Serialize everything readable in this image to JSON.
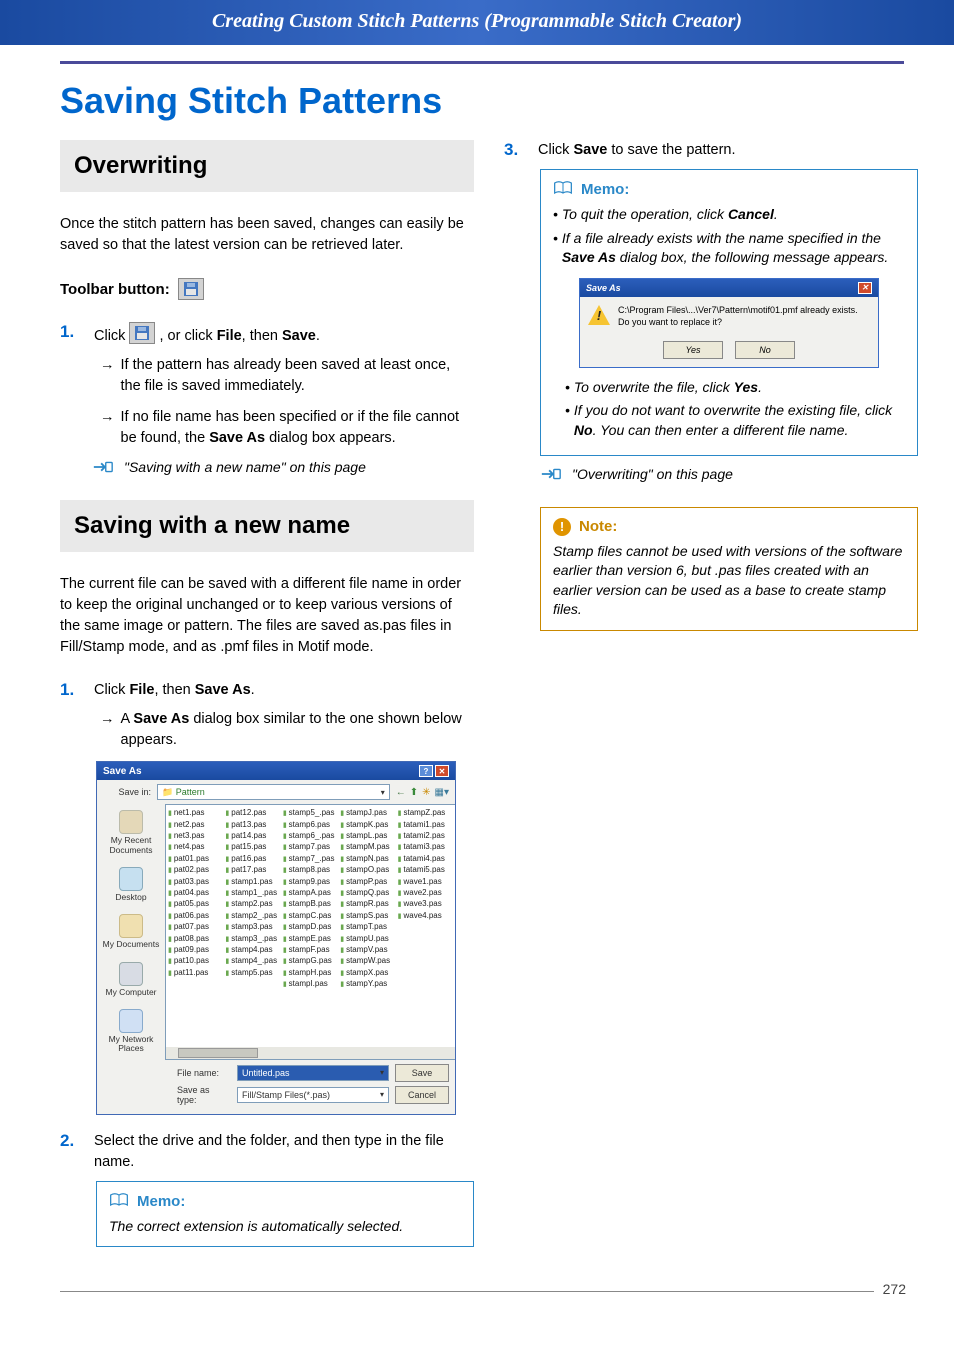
{
  "header_title": "Creating Custom Stitch Patterns (Programmable Stitch Creator)",
  "page_title": "Saving Stitch Patterns",
  "page_number": "272",
  "left": {
    "section1_heading": "Overwriting",
    "section1_intro": "Once the stitch pattern has been saved, changes can easily be saved so that the latest version can be retrieved later.",
    "toolbar_label": "Toolbar button:",
    "step1_num": "1.",
    "step1_pre": "Click ",
    "step1_mid": " , or click ",
    "step1_b1": "File",
    "step1_mid2": ", then ",
    "step1_b2": "Save",
    "step1_end": ".",
    "arrow1": "If the pattern has already been saved at least once, the file is saved immediately.",
    "arrow2_pre": "If no file name has been specified or if the file cannot be found, the ",
    "arrow2_b": "Save As",
    "arrow2_post": " dialog box appears.",
    "xref1": "\"Saving with a new name\" on this page",
    "section2_heading": "Saving with a new name",
    "section2_intro": "The current file can be saved with a different file name in order to keep the original unchanged or to keep various versions of the same image or pattern. The files are saved as.pas files in Fill/Stamp mode, and as .pmf files in Motif mode.",
    "s2_step1_num": "1.",
    "s2_step1_pre": "Click ",
    "s2_step1_b1": "File",
    "s2_step1_mid": ", then ",
    "s2_step1_b2": "Save As",
    "s2_step1_end": ".",
    "s2_arrow_pre": "A ",
    "s2_arrow_b": "Save As",
    "s2_arrow_post": " dialog box similar to the one shown below appears.",
    "s2_step2_num": "2.",
    "s2_step2_text": "Select the drive and the folder, and then type in the file name.",
    "memo1_label": "Memo:",
    "memo1_body": "The correct extension is automatically selected.",
    "dialog": {
      "title": "Save As",
      "savein_label": "Save in:",
      "savein_value": "Pattern",
      "sidebar": [
        "My Recent Documents",
        "Desktop",
        "My Documents",
        "My Computer",
        "My Network Places"
      ],
      "cols": [
        [
          "net1.pas",
          "net2.pas",
          "net3.pas",
          "net4.pas",
          "pat01.pas",
          "pat02.pas",
          "pat03.pas",
          "pat04.pas",
          "pat05.pas",
          "pat06.pas",
          "pat07.pas",
          "pat08.pas",
          "pat09.pas",
          "pat10.pas",
          "pat11.pas"
        ],
        [
          "pat12.pas",
          "pat13.pas",
          "pat14.pas",
          "pat15.pas",
          "pat16.pas",
          "pat17.pas",
          "stamp1.pas",
          "stamp1_.pas",
          "stamp2.pas",
          "stamp2_.pas",
          "stamp3.pas",
          "stamp3_.pas",
          "stamp4.pas",
          "stamp4_.pas",
          "stamp5.pas"
        ],
        [
          "stamp5_.pas",
          "stamp6.pas",
          "stamp6_.pas",
          "stamp7.pas",
          "stamp7_.pas",
          "stamp8.pas",
          "stamp9.pas",
          "stampA.pas",
          "stampB.pas",
          "stampC.pas",
          "stampD.pas",
          "stampE.pas",
          "stampF.pas",
          "stampG.pas",
          "stampH.pas",
          "stampI.pas"
        ],
        [
          "stampJ.pas",
          "stampK.pas",
          "stampL.pas",
          "stampM.pas",
          "stampN.pas",
          "stampO.pas",
          "stampP.pas",
          "stampQ.pas",
          "stampR.pas",
          "stampS.pas",
          "stampT.pas",
          "stampU.pas",
          "stampV.pas",
          "stampW.pas",
          "stampX.pas",
          "stampY.pas"
        ],
        [
          "stampZ.pas",
          "tatami1.pas",
          "tatami2.pas",
          "tatami3.pas",
          "tatami4.pas",
          "tatami5.pas",
          "wave1.pas",
          "wave2.pas",
          "wave3.pas",
          "wave4.pas"
        ]
      ],
      "filename_label": "File name:",
      "filename_value": "Untitled.pas",
      "savetype_label": "Save as type:",
      "savetype_value": "Fill/Stamp Files(*.pas)",
      "btn_save": "Save",
      "btn_cancel": "Cancel"
    }
  },
  "right": {
    "step3_num": "3.",
    "step3_pre": "Click ",
    "step3_b": "Save",
    "step3_post": " to save the pattern.",
    "memo2_label": "Memo:",
    "memo2_li1_pre": "To quit the operation, click ",
    "memo2_li1_b": "Cancel",
    "memo2_li1_post": ".",
    "memo2_li2_pre": "If a file already exists with the name specified in the ",
    "memo2_li2_b": "Save As",
    "memo2_li2_post": " dialog box, the following message appears.",
    "alert": {
      "title": "Save As",
      "msg": "C:\\Program Files\\...\\Ver7\\Pattern\\motif01.pmf already exists.\nDo you want to replace it?",
      "yes": "Yes",
      "no": "No"
    },
    "memo2_li3_pre": "To overwrite the file, click ",
    "memo2_li3_b": "Yes",
    "memo2_li3_post": ".",
    "memo2_li4_pre": "If you do not want to overwrite the existing file, click ",
    "memo2_li4_b": "No",
    "memo2_li4_post": ". You can then enter a different file name.",
    "xref2": "\"Overwriting\" on this page",
    "note_label": "Note:",
    "note_body": "Stamp files cannot be used with versions of the software earlier than version 6, but .pas files created with an earlier version can be used as a base to create stamp files."
  }
}
